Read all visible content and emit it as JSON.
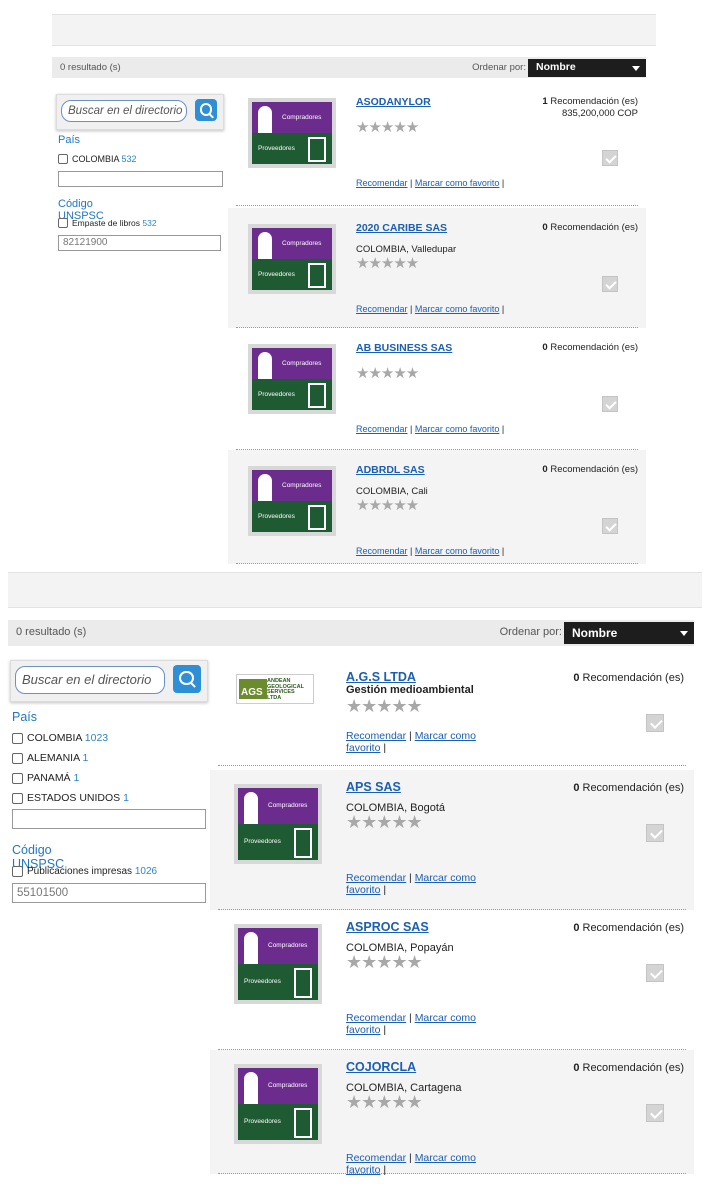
{
  "colors": {
    "accent": "#1f78c1",
    "link": "#1a5fb4",
    "select_bg": "#1d1d1d",
    "logo_top": "#6b2c8e",
    "logo_bottom": "#1e5a32"
  },
  "panels": [
    {
      "results_label": "0 resultado (s)",
      "order_label": "Ordenar por:",
      "order_value": "Nombre",
      "search_placeholder": "Buscar en el directorio",
      "country_heading": "País",
      "countries": [
        {
          "label": "COLOMBIA",
          "count": "532"
        }
      ],
      "country_filter_value": "",
      "unspsc_heading": "Código UNSPSC",
      "unspsc_options": [
        {
          "label": "Empaste de libros",
          "count": "532"
        }
      ],
      "unspsc_value": "82121900",
      "results": [
        {
          "name": "ASODANYLOR",
          "location": "",
          "rec_count": "1",
          "rec_label": "Recomendación (es)",
          "price": "835,200,000 COP",
          "logo": "compradores-proveedores",
          "logo_top": "Compradores",
          "logo_bottom": "Proveedores",
          "stars": "★★★★★",
          "recommend": "Recomendar",
          "sep": " | ",
          "favorite": "Marcar como favorito",
          "end": " |"
        },
        {
          "name": "2020 CARIBE SAS",
          "location": "COLOMBIA, Valledupar",
          "rec_count": "0",
          "rec_label": "Recomendación (es)",
          "price": "",
          "logo": "compradores-proveedores",
          "logo_top": "Compradores",
          "logo_bottom": "Proveedores",
          "stars": "★★★★★",
          "recommend": "Recomendar",
          "sep": " | ",
          "favorite": "Marcar como favorito",
          "end": " |"
        },
        {
          "name": "AB BUSINESS SAS",
          "location": "",
          "rec_count": "0",
          "rec_label": "Recomendación (es)",
          "price": "",
          "logo": "compradores-proveedores",
          "logo_top": "Compradores",
          "logo_bottom": "Proveedores",
          "stars": "★★★★★",
          "recommend": "Recomendar",
          "sep": " | ",
          "favorite": "Marcar como favorito",
          "end": " |"
        },
        {
          "name": "ADBRDL SAS",
          "location": "COLOMBIA, Cali",
          "rec_count": "0",
          "rec_label": "Recomendación (es)",
          "price": "",
          "logo": "compradores-proveedores",
          "logo_top": "Compradores",
          "logo_bottom": "Proveedores",
          "stars": "★★★★★",
          "recommend": "Recomendar",
          "sep": " | ",
          "favorite": "Marcar como favorito",
          "end": " |"
        }
      ]
    },
    {
      "results_label": "0 resultado (s)",
      "order_label": "Ordenar por:",
      "order_value": "Nombre",
      "search_placeholder": "Buscar en el directorio",
      "country_heading": "País",
      "countries": [
        {
          "label": "COLOMBIA",
          "count": "1023"
        },
        {
          "label": "ALEMANIA",
          "count": "1"
        },
        {
          "label": "PANAMÁ",
          "count": "1"
        },
        {
          "label": "ESTADOS UNIDOS",
          "count": "1"
        }
      ],
      "country_filter_value": "",
      "unspsc_heading": "Código UNSPSC",
      "unspsc_options": [
        {
          "label": "Publicaciones impresas",
          "count": "1026"
        }
      ],
      "unspsc_value": "55101500",
      "results": [
        {
          "name": "A.G.S LTDA",
          "location": "Gestión medioambiental",
          "rec_count": "0",
          "rec_label": "Recomendación (es)",
          "price": "",
          "logo": "ags",
          "logo_top": "ANDEAN GEOLOGICAL SERVICES LTDA",
          "logo_bottom": "AGS",
          "stars": "★★★★★",
          "recommend": "Recomendar",
          "sep": " | ",
          "favorite": "Marcar como favorito",
          "end": " |"
        },
        {
          "name": "APS SAS",
          "location": "COLOMBIA, Bogotá",
          "rec_count": "0",
          "rec_label": "Recomendación (es)",
          "price": "",
          "logo": "compradores-proveedores",
          "logo_top": "Compradores",
          "logo_bottom": "Proveedores",
          "stars": "★★★★★",
          "recommend": "Recomendar",
          "sep": " | ",
          "favorite": "Marcar como favorito",
          "end": " |"
        },
        {
          "name": "ASPROC SAS",
          "location": "COLOMBIA, Popayán",
          "rec_count": "0",
          "rec_label": "Recomendación (es)",
          "price": "",
          "logo": "compradores-proveedores",
          "logo_top": "Compradores",
          "logo_bottom": "Proveedores",
          "stars": "★★★★★",
          "recommend": "Recomendar",
          "sep": " | ",
          "favorite": "Marcar como favorito",
          "end": " |"
        },
        {
          "name": "COJORCLA",
          "location": "COLOMBIA, Cartagena",
          "rec_count": "0",
          "rec_label": "Recomendación (es)",
          "price": "",
          "logo": "compradores-proveedores",
          "logo_top": "Compradores",
          "logo_bottom": "Proveedores",
          "stars": "★★★★★",
          "recommend": "Recomendar",
          "sep": " | ",
          "favorite": "Marcar como favorito",
          "end": " |"
        }
      ]
    }
  ]
}
